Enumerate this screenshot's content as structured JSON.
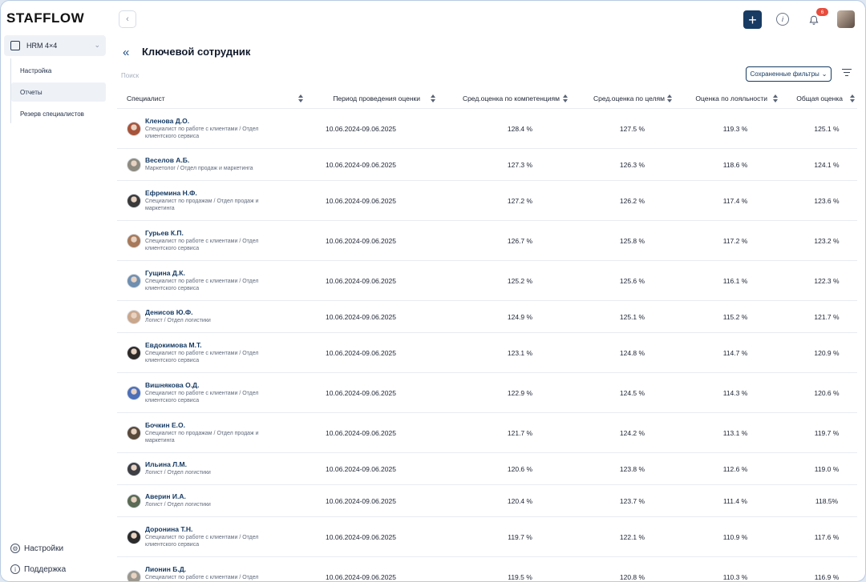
{
  "app": {
    "logo": "STAFFLOW"
  },
  "sidebar": {
    "module_label": "HRM 4×4",
    "items": [
      {
        "label": "Настройка",
        "active": false
      },
      {
        "label": "Отчеты",
        "active": true
      },
      {
        "label": "Резерв специалистов",
        "active": false
      }
    ],
    "settings_label": "Настройки",
    "support_label": "Поддержка"
  },
  "topbar": {
    "notification_count": "6"
  },
  "page": {
    "title": "Ключевой сотрудник",
    "search_placeholder": "Поиск",
    "saved_filters_label": "Сохраненные фильтры"
  },
  "table": {
    "headers": {
      "specialist": "Специалист",
      "period": "Период проведения оценки",
      "competencies": "Сред.оценка по компетенциям",
      "goals": "Сред.оценка по целям",
      "loyalty": "Оценка по лояльности",
      "total": "Общая оценка"
    },
    "rows": [
      {
        "name": "Кленова Д.О.",
        "role": "Специалист по работе с клиентами / Отдел клиентского сервиса",
        "period": "10.06.2024-09.06.2025",
        "competencies": "128.4 %",
        "goals": "127.5 %",
        "loyalty": "119.3 %",
        "total": "125.1 %",
        "avatar_color": "#a8543a"
      },
      {
        "name": "Веселов А.Б.",
        "role": "Маркетолог / Отдел продаж и маркетинга",
        "period": "10.06.2024-09.06.2025",
        "competencies": "127.3 %",
        "goals": "126.3 %",
        "loyalty": "118.6 %",
        "total": "124.1 %",
        "avatar_color": "#8d8a80"
      },
      {
        "name": "Ефремина Н.Ф.",
        "role": "Специалист по продажам / Отдел продаж и маркетинга",
        "period": "10.06.2024-09.06.2025",
        "competencies": "127.2 %",
        "goals": "126.2 %",
        "loyalty": "117.4 %",
        "total": "123.6 %",
        "avatar_color": "#3a3a3a"
      },
      {
        "name": "Гурьев К.П.",
        "role": "Специалист по работе с клиентами / Отдел клиентского сервиса",
        "period": "10.06.2024-09.06.2025",
        "competencies": "126.7 %",
        "goals": "125.8 %",
        "loyalty": "117.2 %",
        "total": "123.2 %",
        "avatar_color": "#a7795a"
      },
      {
        "name": "Гущина Д.К.",
        "role": "Специалист по работе с клиентами / Отдел клиентского сервиса",
        "period": "10.06.2024-09.06.2025",
        "competencies": "125.2 %",
        "goals": "125.6 %",
        "loyalty": "116.1 %",
        "total": "122.3 %",
        "avatar_color": "#6f8fb0"
      },
      {
        "name": "Денисов Ю.Ф.",
        "role": "Логист / Отдел логистики",
        "period": "10.06.2024-09.06.2025",
        "competencies": "124.9 %",
        "goals": "125.1 %",
        "loyalty": "115.2 %",
        "total": "121.7 %",
        "avatar_color": "#c9a78c"
      },
      {
        "name": "Евдокимова М.Т.",
        "role": "Специалист по работе с клиентами / Отдел клиентского сервиса",
        "period": "10.06.2024-09.06.2025",
        "competencies": "123.1 %",
        "goals": "124.8 %",
        "loyalty": "114.7 %",
        "total": "120.9 %",
        "avatar_color": "#2f2a28"
      },
      {
        "name": "Вишнякова О.Д.",
        "role": "Специалист по работе с клиентами / Отдел клиентского сервиса",
        "period": "10.06.2024-09.06.2025",
        "competencies": "122.9 %",
        "goals": "124.5 %",
        "loyalty": "114.3 %",
        "total": "120.6 %",
        "avatar_color": "#4c6fb8"
      },
      {
        "name": "Бочкин Е.О.",
        "role": "Специалист по продажам / Отдел продаж и маркетинга",
        "period": "10.06.2024-09.06.2025",
        "competencies": "121.7 %",
        "goals": "124.2 %",
        "loyalty": "113.1 %",
        "total": "119.7 %",
        "avatar_color": "#5a4a3c"
      },
      {
        "name": "Ильина Л.М.",
        "role": "Логист / Отдел логистики",
        "period": "10.06.2024-09.06.2025",
        "competencies": "120.6 %",
        "goals": "123.8 %",
        "loyalty": "112.6 %",
        "total": "119.0 %",
        "avatar_color": "#3d3f45"
      },
      {
        "name": "Аверин И.А.",
        "role": "Логист / Отдел логистики",
        "period": "10.06.2024-09.06.2025",
        "competencies": "120.4 %",
        "goals": "123.7 %",
        "loyalty": "111.4 %",
        "total": "118.5%",
        "avatar_color": "#5a6a54"
      },
      {
        "name": "Доронина Т.Н.",
        "role": "Специалист по работе с клиентами / Отдел клиентского сервиса",
        "period": "10.06.2024-09.06.2025",
        "competencies": "119.7 %",
        "goals": "122.1 %",
        "loyalty": "110.9 %",
        "total": "117.6 %",
        "avatar_color": "#2b2b2b"
      },
      {
        "name": "Лионин Б.Д.",
        "role": "Специалист по работе с клиентами / Отдел клиентского сервиса",
        "period": "10.06.2024-09.06.2025",
        "competencies": "119.5 %",
        "goals": "120.8 %",
        "loyalty": "110.3 %",
        "total": "116.9 %",
        "avatar_color": "#9a9890"
      }
    ]
  }
}
